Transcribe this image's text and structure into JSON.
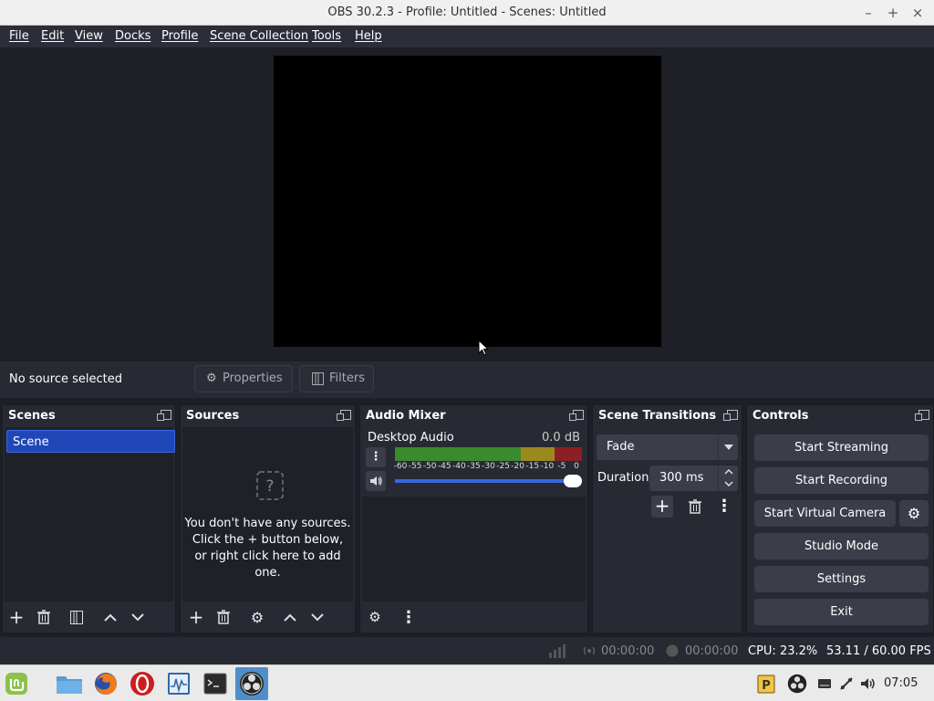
{
  "window": {
    "title": "OBS 30.2.3 - Profile: Untitled - Scenes: Untitled",
    "minimize": "–",
    "maximize": "+",
    "close": "×"
  },
  "menu": [
    "File",
    "Edit",
    "View",
    "Docks",
    "Profile",
    "Scene Collection",
    "Tools",
    "Help"
  ],
  "source_bar": {
    "status": "No source selected",
    "properties": "Properties",
    "filters": "Filters"
  },
  "docks": {
    "scenes": {
      "title": "Scenes",
      "items": [
        "Scene"
      ]
    },
    "sources": {
      "title": "Sources",
      "empty_line1": "You don't have any sources.",
      "empty_line2": "Click the + button below,",
      "empty_line3": "or right click here to add one."
    },
    "audio_mixer": {
      "title": "Audio Mixer",
      "channel": "Desktop Audio",
      "level": "0.0 dB",
      "meter_ticks": [
        "-60",
        "-55",
        "-50",
        "-45",
        "-40",
        "-35",
        "-30",
        "-25",
        "-20",
        "-15",
        "-10",
        "-5",
        "0"
      ],
      "volume_fraction": 1.0
    },
    "transitions": {
      "title": "Scene Transitions",
      "selected": "Fade",
      "duration_label": "Duration",
      "duration_value": "300 ms"
    },
    "controls": {
      "title": "Controls",
      "start_streaming": "Start Streaming",
      "start_recording": "Start Recording",
      "start_virtual_camera": "Start Virtual Camera",
      "studio_mode": "Studio Mode",
      "settings": "Settings",
      "exit": "Exit"
    }
  },
  "status": {
    "stream_time": "00:00:00",
    "record_time": "00:00:00",
    "cpu": "CPU: 23.2%",
    "fps": "53.11 / 60.00 FPS"
  },
  "taskbar": {
    "clock": "07:05"
  },
  "colors": {
    "accent": "#1f47b8",
    "panel": "#272a33",
    "meter_green": "#3c8a2e",
    "meter_yellow": "#9a8a1e",
    "meter_red": "#8c1e26",
    "slider": "#3a67e0"
  }
}
